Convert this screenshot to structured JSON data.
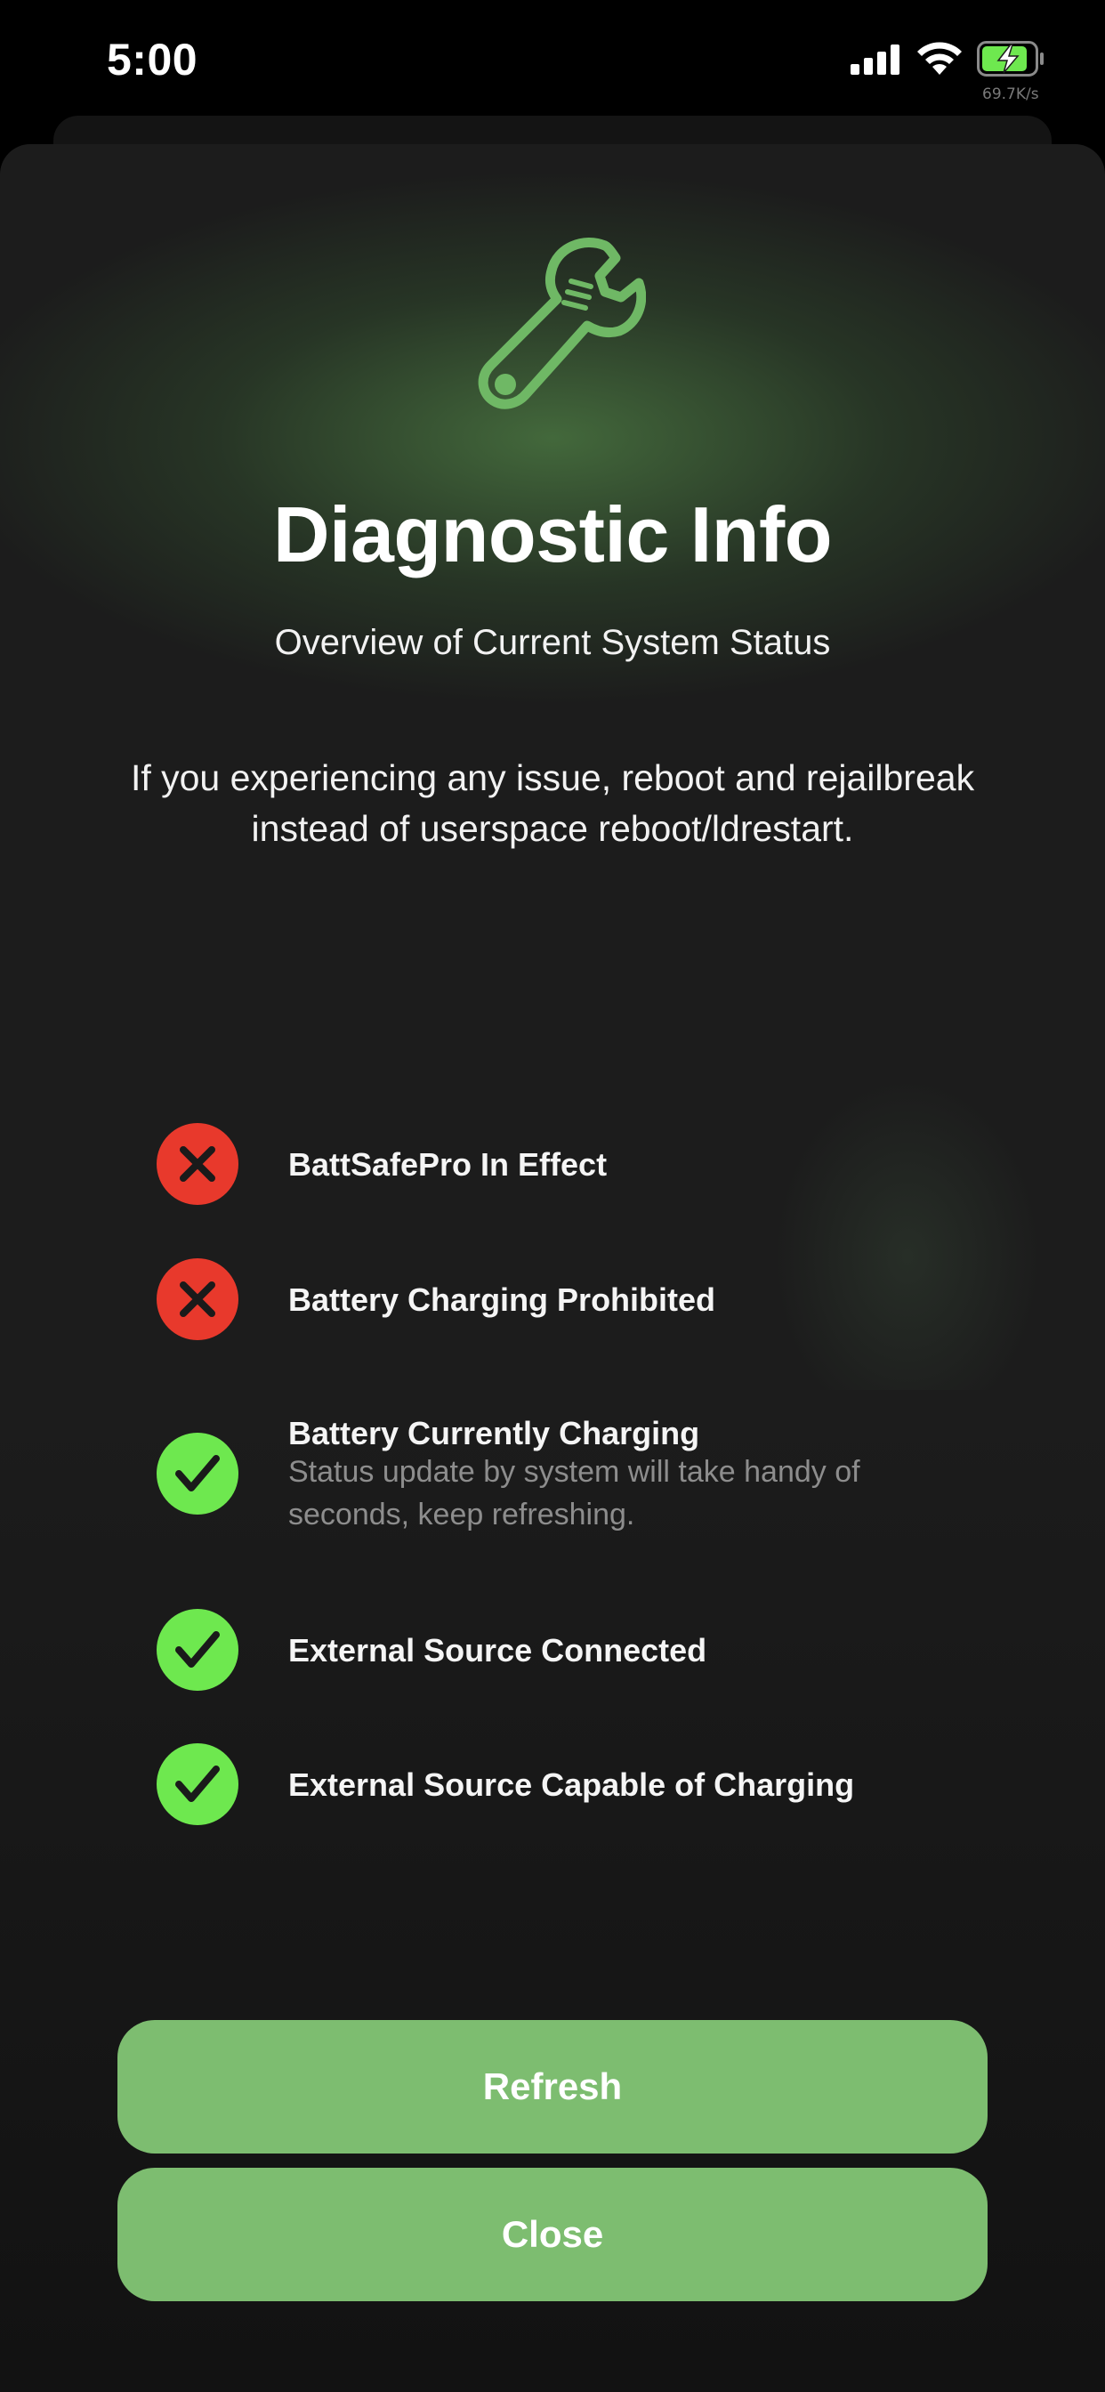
{
  "status_bar": {
    "time": "5:00",
    "network_speed": "69.7K/s",
    "icons": [
      "signal-icon",
      "wifi-icon",
      "battery-charging-icon"
    ]
  },
  "header": {
    "icon": "wrench-icon",
    "title": "Diagnostic Info",
    "subtitle": "Overview of Current System Status",
    "message": "If you experiencing any issue, reboot and rejailbreak instead of userspace reboot/ldrestart."
  },
  "status_items": [
    {
      "label": "BattSafePro In Effect",
      "state": "no",
      "icon": "x-icon",
      "color": "#e8392c"
    },
    {
      "label": "Battery Charging Prohibited",
      "state": "no",
      "icon": "x-icon",
      "color": "#e8392c"
    },
    {
      "label": "Battery Currently Charging",
      "state": "yes",
      "icon": "check-icon",
      "color": "#6ee84f",
      "note": "Status update by system will take handy of seconds, keep refreshing."
    },
    {
      "label": "External Source Connected",
      "state": "yes",
      "icon": "check-icon",
      "color": "#6ee84f"
    },
    {
      "label": "External Source Capable of Charging",
      "state": "yes",
      "icon": "check-icon",
      "color": "#6ee84f"
    }
  ],
  "buttons": {
    "refresh_label": "Refresh",
    "close_label": "Close"
  },
  "colors": {
    "accent": "#7dbd70",
    "error": "#e8392c",
    "success": "#6ee84f",
    "background": "#1c1c1c"
  }
}
